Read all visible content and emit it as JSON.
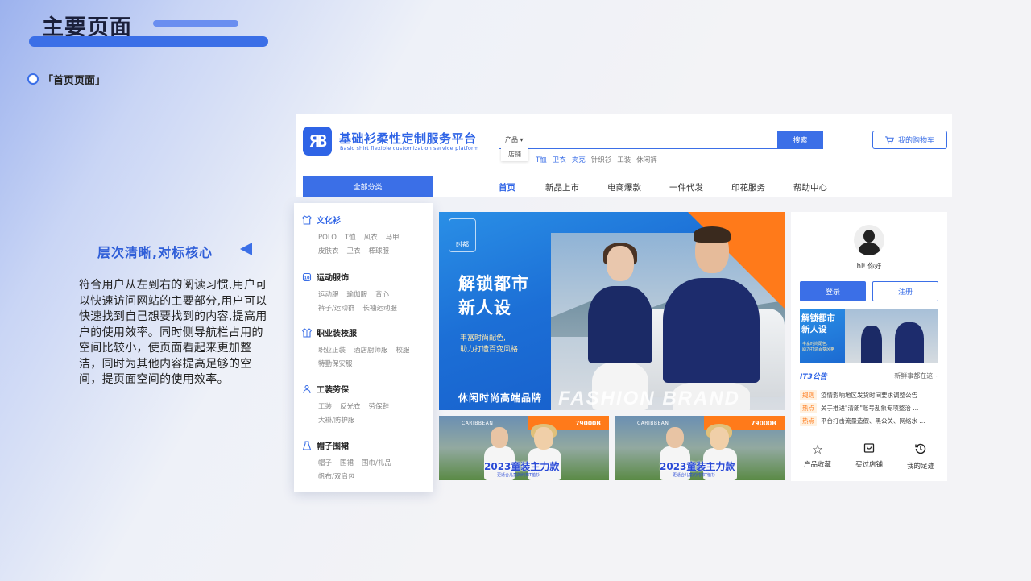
{
  "slide": {
    "title": "主要页面",
    "subtitle": "「首页页面」",
    "highlight": "层次清晰,对标核心",
    "description": "符合用户从左到右的阅读习惯,用户可以快速访问网站的主要部分,用户可以快速找到自己想要找到的内容,提高用户的使用效率。同时侧导航栏占用的空间比较小，使页面看起来更加整洁，同时为其他内容提高足够的空间，提页面空间的使用效率。"
  },
  "header": {
    "logo_mark": "ЯB",
    "logo_cn": "基础衫柔性定制服务平台",
    "logo_en": "Basic shirt flexible customization service platform",
    "search_category": "产品",
    "search_dropdown_option": "店铺",
    "search_button": "搜索",
    "hot_words": [
      "T恤",
      "卫衣",
      "夹克",
      "针织衫",
      "工装",
      "休闲裤"
    ],
    "cart": "我的购物车",
    "all_categories": "全部分类"
  },
  "nav": {
    "items": [
      "首页",
      "新品上市",
      "电商爆款",
      "一件代发",
      "印花服务",
      "帮助中心"
    ]
  },
  "sidebar": {
    "categories": [
      {
        "name": "文化衫",
        "icon": "shirt-icon",
        "items": [
          "POLO",
          "T恤",
          "风衣",
          "马甲",
          "皮肤衣",
          "卫衣",
          "棒球服"
        ]
      },
      {
        "name": "运动服饰",
        "icon": "sport-jersey-icon",
        "items": [
          "运动服",
          "瑜伽服",
          "背心",
          "裤子/运动群",
          "长袖运动服"
        ]
      },
      {
        "name": "职业装校服",
        "icon": "uniform-icon",
        "items": [
          "职业正装",
          "酒店厨师服",
          "校服",
          "特勤保安服"
        ]
      },
      {
        "name": "工装劳保",
        "icon": "worker-icon",
        "items": [
          "工装",
          "反光衣",
          "劳保鞋",
          "大褂/防护服"
        ]
      },
      {
        "name": "帽子围裙",
        "icon": "apron-icon",
        "items": [
          "帽子",
          "围裙",
          "围巾/礼品",
          "帆布/双肩包"
        ]
      }
    ]
  },
  "banner": {
    "brand": "时都",
    "headline_1": "解锁都市",
    "headline_2": "新人设",
    "tagline_1": "丰富时尚配色,",
    "tagline_2": "助力打造百变风格",
    "footer": "休闲时尚高端品牌",
    "overlay_text": "FASHION BRAND"
  },
  "ads": [
    {
      "brand": "CARIBBEAN",
      "price": "79000B",
      "title": "2023童装主力款",
      "subtitle": "更适合儿童的纯棉T恤衫"
    },
    {
      "brand": "CARIBBEAN",
      "price": "79000B",
      "title": "2023童装主力款",
      "subtitle": "更适合儿童的纯棉T恤衫"
    }
  ],
  "user_panel": {
    "greeting": "hi! 你好",
    "login": "登录",
    "register": "注册",
    "mini_banner_1": "解锁都市",
    "mini_banner_2": "新人设",
    "mini_banner_small_1": "丰富时尚配色,",
    "mini_banner_small_2": "助力打造百变风格",
    "notice_title": "IT3公告",
    "notice_more": "新鲜事都在这~",
    "notices": [
      {
        "tag": "规则",
        "text": "疫情影响地区发货时间要求调整公告"
      },
      {
        "tag": "热点",
        "text": "关于推进\"清朗\"账号乱象专项整治 ..."
      },
      {
        "tag": "热点",
        "text": "平台打击流量造假、黑公关、网络水 ..."
      }
    ],
    "quick_links": [
      {
        "label": "产品收藏",
        "icon": "star-icon"
      },
      {
        "label": "买过店铺",
        "icon": "store-bag-icon"
      },
      {
        "label": "我的足迹",
        "icon": "history-icon"
      }
    ]
  },
  "colors": {
    "primary": "#3b6fe7",
    "accent_orange": "#ff7a1a",
    "title_dark": "#1a1f3a"
  }
}
